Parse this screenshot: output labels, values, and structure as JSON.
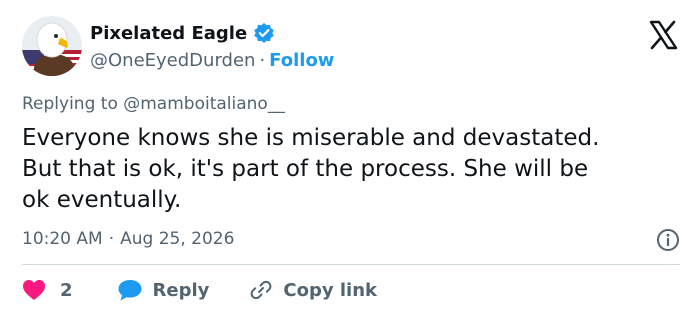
{
  "author": {
    "name": "Pixelated Eagle",
    "handle": "@OneEyedDurden",
    "separator": "·",
    "follow_label": "Follow",
    "verified": true
  },
  "reply_to": {
    "prefix": "Replying to",
    "handle": "@mamboitaliano__"
  },
  "tweet": {
    "text": "Everyone knows she is miserable and devastated.\nBut that is ok, it's part of the process. She will be\nok eventually."
  },
  "meta": {
    "time": "10:20 AM",
    "separator": "·",
    "date": "Aug 25, 2026"
  },
  "actions": {
    "like_count": "2",
    "reply_label": "Reply",
    "copy_label": "Copy link"
  },
  "icons": {
    "brand": "x-logo-icon",
    "verified": "verified-badge-icon",
    "info": "info-icon",
    "like": "heart-icon",
    "reply": "speech-bubble-icon",
    "copy": "link-icon"
  },
  "colors": {
    "accent": "#1d9bf0",
    "like": "#f91880",
    "text": "#0f1419",
    "muted": "#536471",
    "divider": "#cfd9de"
  }
}
